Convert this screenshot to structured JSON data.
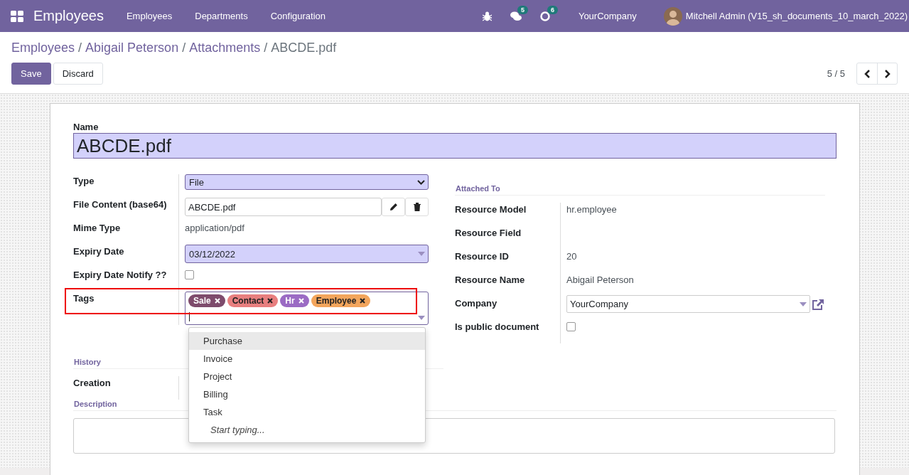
{
  "navbar": {
    "app_title": "Employees",
    "menu": [
      "Employees",
      "Departments",
      "Configuration"
    ],
    "messages_badge": "5",
    "activities_badge": "6",
    "company": "YourCompany",
    "user": "Mitchell Admin (V15_sh_documents_10_march_2022)"
  },
  "breadcrumbs": [
    {
      "label": "Employees",
      "kind": "link"
    },
    {
      "label": "/",
      "kind": "separator"
    },
    {
      "label": "Abigail Peterson",
      "kind": "link"
    },
    {
      "label": "/",
      "kind": "separator"
    },
    {
      "label": "Attachments",
      "kind": "link"
    },
    {
      "label": "/",
      "kind": "separator"
    },
    {
      "label": "ABCDE.pdf",
      "kind": "current"
    }
  ],
  "buttons": [
    {
      "label": "Save",
      "kind": "primary"
    },
    {
      "label": "Discard",
      "kind": "secondary"
    }
  ],
  "pager": "5 / 5",
  "form": {
    "name_label": "Name",
    "name_value": "ABCDE.pdf",
    "left_fields": [
      {
        "label": "Type",
        "kind": "select",
        "value": "File"
      },
      {
        "label": "File Content (base64)",
        "kind": "binary",
        "value": "ABCDE.pdf"
      },
      {
        "label": "Mime Type",
        "kind": "text",
        "value": "application/pdf"
      },
      {
        "label": "Expiry Date",
        "kind": "date",
        "value": "03/12/2022"
      },
      {
        "label": "Expiry Date Notify ??",
        "kind": "checkbox",
        "checked": false
      },
      {
        "label": "Tags",
        "kind": "tags",
        "highlight": true,
        "tags": [
          {
            "label": "Sale",
            "color": "#7e4b6c"
          },
          {
            "label": "Contact",
            "color": "#e87f7f"
          },
          {
            "label": "Hr",
            "color": "#9b6bc4"
          },
          {
            "label": "Employee",
            "color": "#f3a55c"
          }
        ]
      }
    ],
    "tag_dropdown": {
      "options": [
        {
          "label": "Purchase",
          "selected": true
        },
        {
          "label": "Invoice",
          "selected": false
        },
        {
          "label": "Project",
          "selected": false
        },
        {
          "label": "Billing",
          "selected": false
        },
        {
          "label": "Task",
          "selected": false
        }
      ],
      "hint": "Start typing..."
    },
    "right_heading": "Attached To",
    "right_fields": [
      {
        "label": "Resource Model",
        "kind": "text",
        "value": "hr.employee"
      },
      {
        "label": "Resource Field",
        "kind": "text"
      },
      {
        "label": "Resource ID",
        "kind": "text",
        "value": "20"
      },
      {
        "label": "Resource Name",
        "kind": "text",
        "value": "Abigail Peterson"
      },
      {
        "label": "Company",
        "kind": "many2one",
        "value": "YourCompany"
      },
      {
        "label": "Is public document",
        "kind": "checkbox",
        "checked": false
      }
    ],
    "history_heading": "History",
    "creation_label": "Creation",
    "description_heading": "Description"
  }
}
